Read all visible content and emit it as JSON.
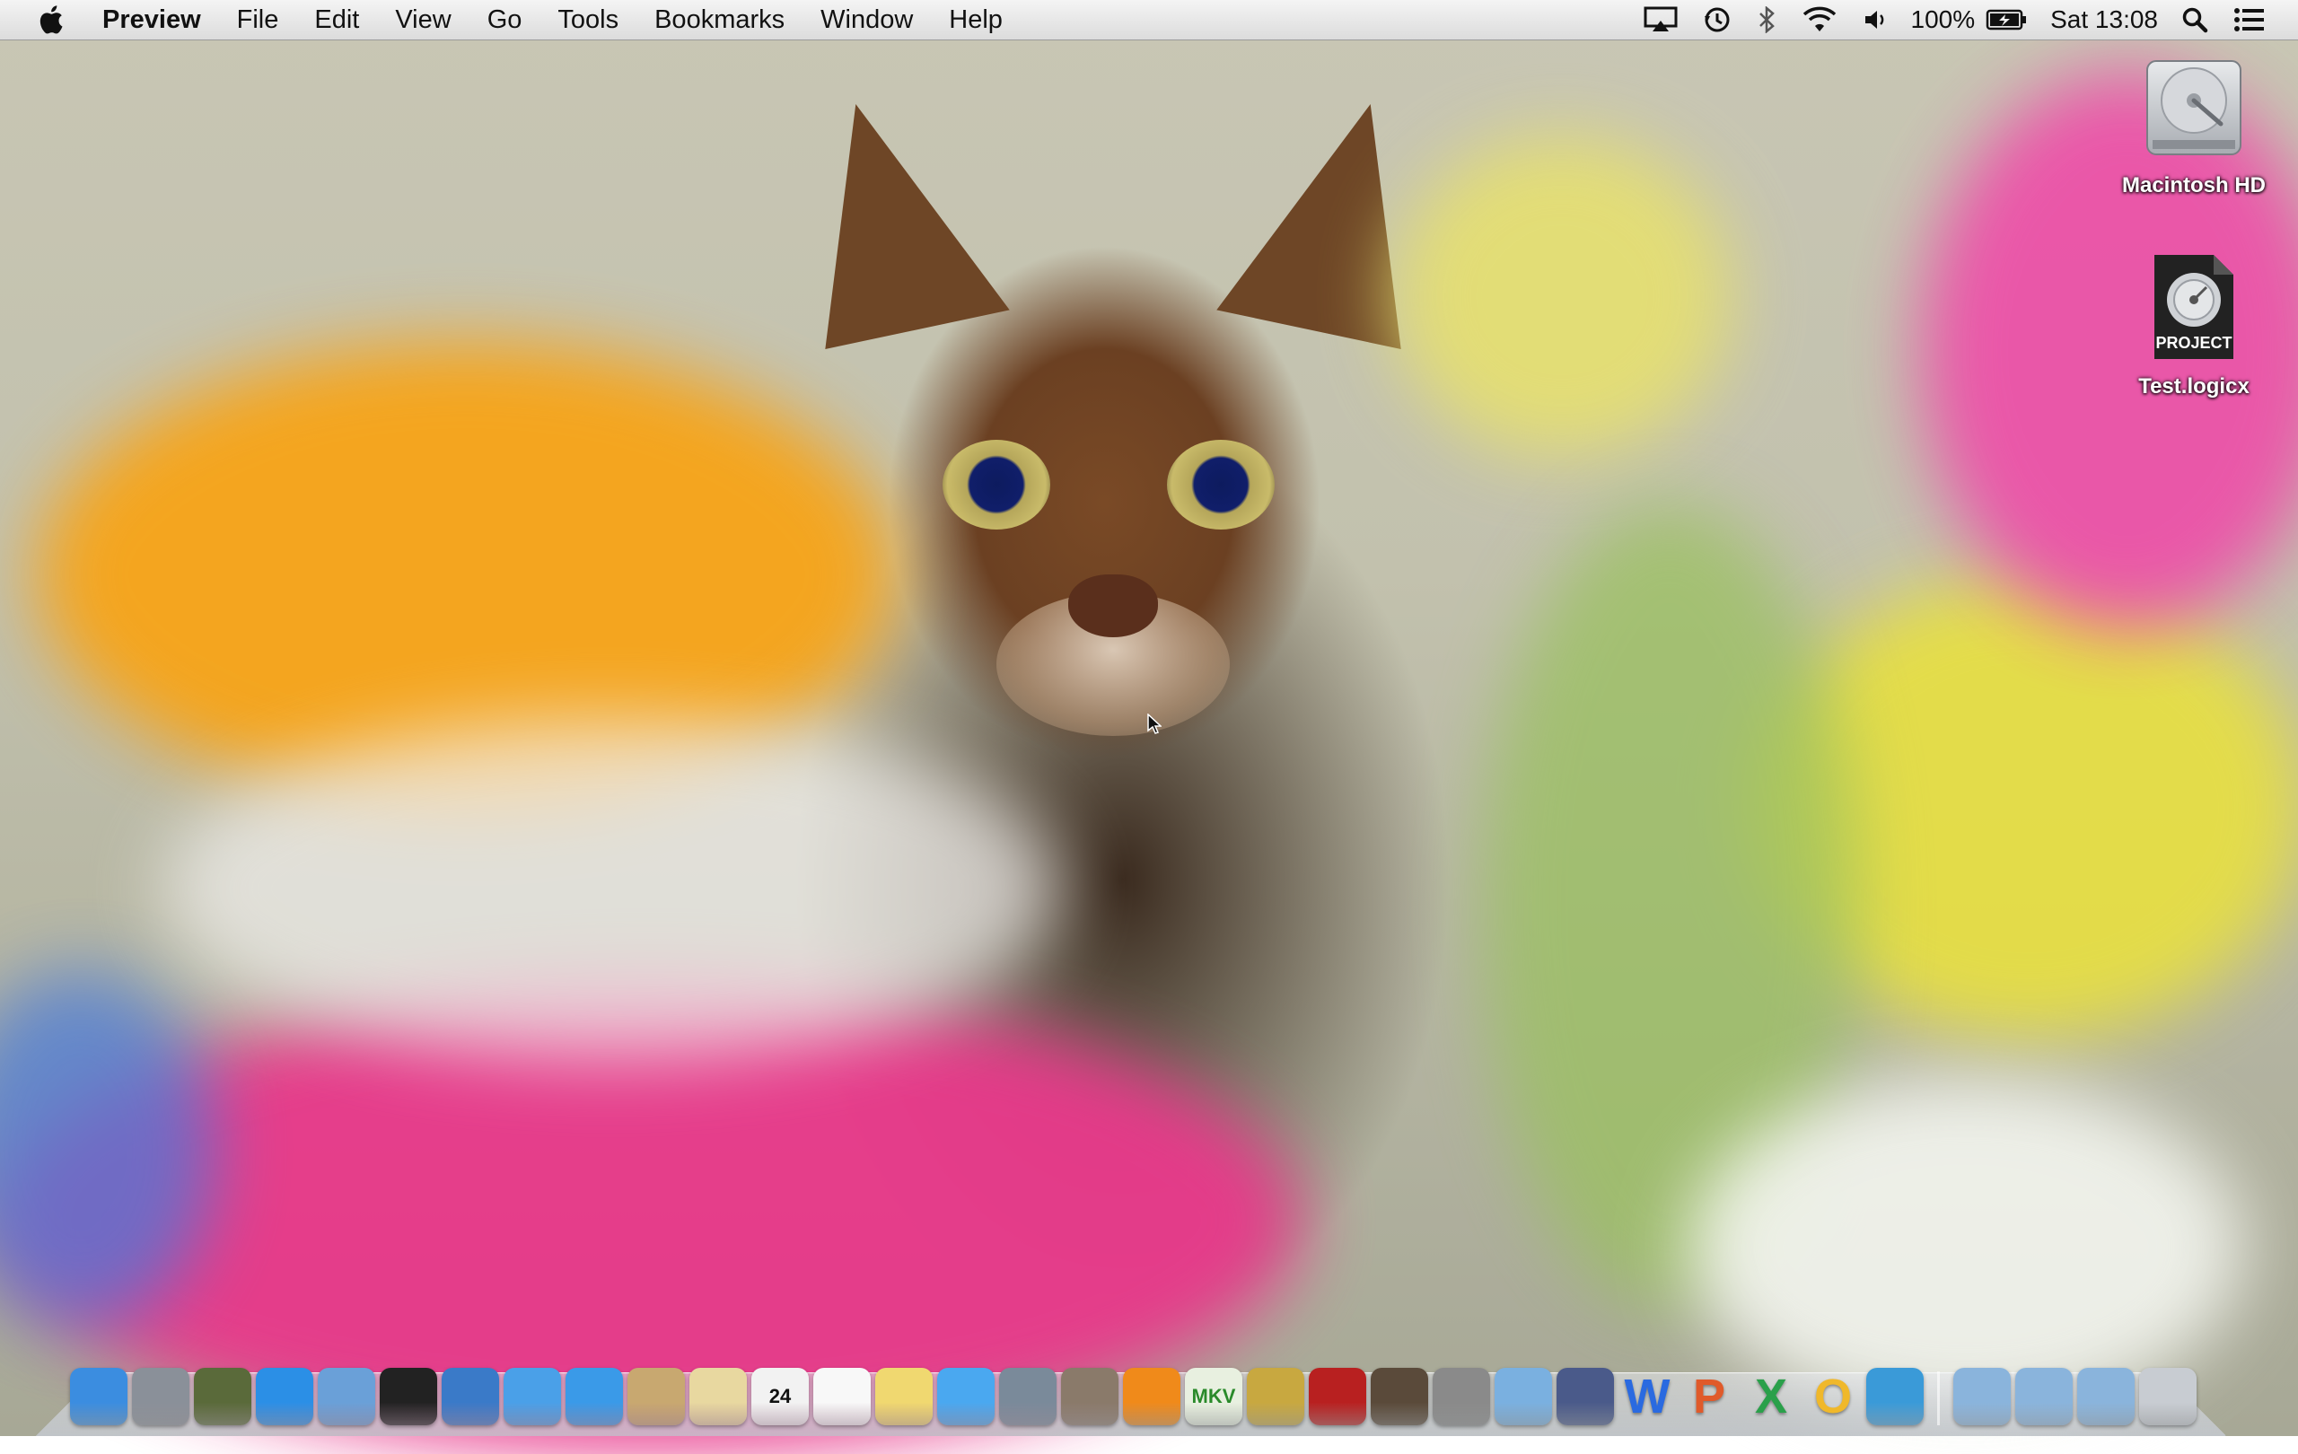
{
  "menubar": {
    "app_name": "Preview",
    "menus": [
      "File",
      "Edit",
      "View",
      "Go",
      "Tools",
      "Bookmarks",
      "Window",
      "Help"
    ],
    "status": {
      "battery_percent": "100%",
      "clock": "Sat 13:08"
    },
    "status_icons": [
      "airplay-icon",
      "time-machine-icon",
      "bluetooth-icon",
      "wifi-icon",
      "volume-icon",
      "battery-icon",
      "spotlight-icon",
      "notification-center-icon"
    ]
  },
  "desktop": {
    "icons": [
      {
        "label": "Macintosh HD",
        "icon": "hard-drive-icon"
      },
      {
        "label": "Test.logicx",
        "icon": "logic-project-icon",
        "badge": "PROJECT"
      }
    ]
  },
  "dock": {
    "apps": [
      {
        "name": "finder-icon",
        "color": "#3b8de0"
      },
      {
        "name": "launchpad-icon",
        "color": "#8a9099"
      },
      {
        "name": "mission-control-icon",
        "color": "#5a6a3a"
      },
      {
        "name": "app-store-icon",
        "color": "#2b8fe6"
      },
      {
        "name": "mail-icon",
        "color": "#6aa0d8"
      },
      {
        "name": "facetime-camera-icon",
        "color": "#222222"
      },
      {
        "name": "network-globe-icon",
        "color": "#3a7ac8"
      },
      {
        "name": "safari-icon",
        "color": "#4aa0e8"
      },
      {
        "name": "itunes-icon",
        "color": "#3a9ae8"
      },
      {
        "name": "contacts-icon",
        "color": "#c8a870"
      },
      {
        "name": "solitaire-icon",
        "color": "#e8d8a0"
      },
      {
        "name": "calendar-icon",
        "color": "#f2f2f2",
        "text": "24"
      },
      {
        "name": "reminders-icon",
        "color": "#f8f8f8"
      },
      {
        "name": "notes-icon",
        "color": "#f0d870"
      },
      {
        "name": "messages-icon",
        "color": "#4aa8f0"
      },
      {
        "name": "facetime-icon",
        "color": "#7a8a9a"
      },
      {
        "name": "photos-icon",
        "color": "#8a7a6a"
      },
      {
        "name": "vlc-icon",
        "color": "#f08a1a"
      },
      {
        "name": "mkv-icon",
        "color": "#e8f0e0",
        "text": "MKV"
      },
      {
        "name": "pineapple-icon",
        "color": "#c8a840"
      },
      {
        "name": "photo-booth-icon",
        "color": "#b82020"
      },
      {
        "name": "image-capture-icon",
        "color": "#5a4a3a"
      },
      {
        "name": "system-preferences-icon",
        "color": "#8a8a8a"
      },
      {
        "name": "preview-icon",
        "color": "#7ab0e0"
      },
      {
        "name": "script-editor-icon",
        "color": "#4a5a8a"
      },
      {
        "name": "word-icon",
        "color": "#2a6ae0",
        "text": "W"
      },
      {
        "name": "powerpoint-icon",
        "color": "#e05a2a",
        "text": "P"
      },
      {
        "name": "excel-icon",
        "color": "#2aa04a",
        "text": "X"
      },
      {
        "name": "outlook-icon",
        "color": "#f0b82a",
        "text": "O"
      },
      {
        "name": "network-utility-icon",
        "color": "#3a9ad8"
      }
    ],
    "stacks": [
      {
        "name": "applications-folder-icon",
        "color": "#8ab4dc"
      },
      {
        "name": "documents-folder-icon",
        "color": "#8ab4dc"
      },
      {
        "name": "downloads-folder-icon",
        "color": "#8ab4dc"
      },
      {
        "name": "trash-icon",
        "color": "#c8ccd2"
      }
    ]
  }
}
